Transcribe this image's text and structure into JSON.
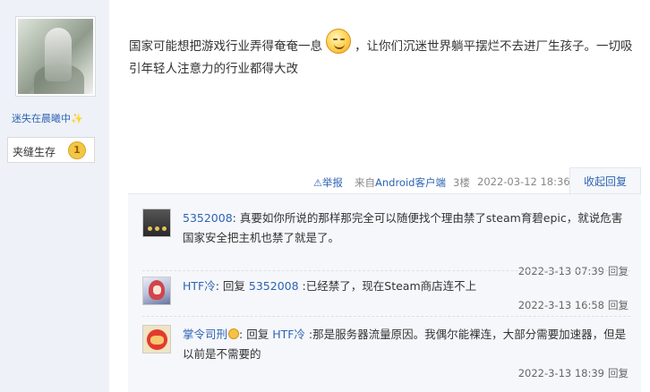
{
  "author": {
    "avatar_icon": "avatar-image",
    "name": "迷失在晨曦中",
    "name_decoration": "✨",
    "badge_label": "夹缝生存",
    "badge_level": "1"
  },
  "post": {
    "text_part1": "国家可能想把游戏行业弄得奄奄一息",
    "text_part2": "，让你们沉迷世界躺平摆烂不去进厂生孩子。一切吸引年轻人注意力的行业都得大改",
    "emoji_icon": "smile-emoji-icon"
  },
  "post_meta": {
    "report_label": "举报",
    "source_prefix": "来自",
    "source_link": "Android客户端",
    "floor": "3楼",
    "timestamp": "2022-03-12 18:36",
    "collapse_label": "收起回复"
  },
  "replies": [
    {
      "author": "5352008",
      "separator": ":",
      "text": " 真要如你所说的那样那完全可以随便找个理由禁了steam育碧epic，就说危害国家安全把主机也禁了就是了。",
      "timestamp": "2022-3-13 07:39",
      "reply_label": "回复"
    },
    {
      "author": "HTF冷",
      "prefix": ": 回复 ",
      "target": "5352008",
      "text": " :已经禁了，现在Steam商店连不上",
      "timestamp": "2022-3-13 16:58",
      "reply_label": "回复"
    },
    {
      "author": "掌令司刑",
      "prefix": ": 回复 ",
      "target": "HTF冷",
      "text": " :那是服务器流量原因。我偶尔能裸连，大部分需要加速器，但是以前是不需要的",
      "timestamp": "2022-3-13 18:39",
      "reply_label": "回复"
    }
  ],
  "colors": {
    "link": "#2d64b3",
    "sidebar_bg": "#eef1f7",
    "reply_bg": "#f6f7fb"
  }
}
